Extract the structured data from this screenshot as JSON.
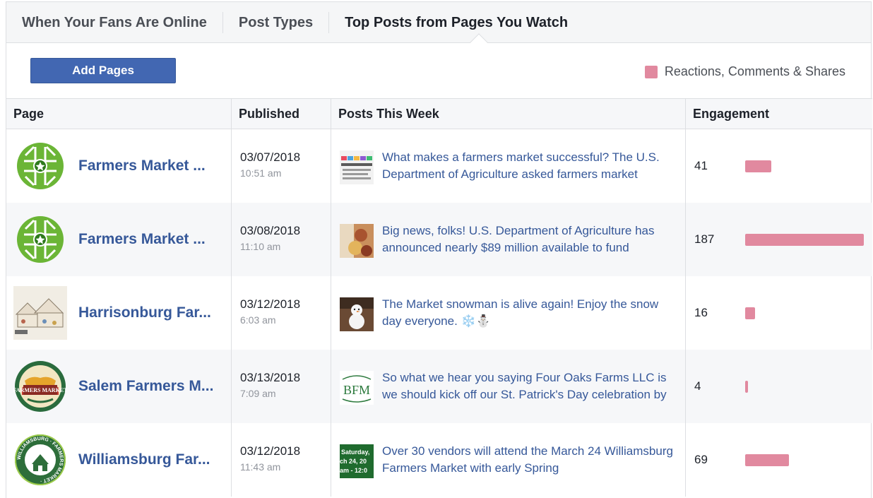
{
  "tabs": [
    {
      "label": "When Your Fans Are Online"
    },
    {
      "label": "Post Types"
    },
    {
      "label": "Top Posts from Pages You Watch"
    }
  ],
  "toolbar": {
    "add_pages_label": "Add Pages",
    "legend_label": "Reactions, Comments & Shares",
    "legend_color": "#e1899f"
  },
  "table": {
    "headers": [
      "Page",
      "Published",
      "Posts This Week",
      "Engagement"
    ],
    "max_engagement": 187,
    "rows": [
      {
        "page": "Farmers Market ...",
        "logo": "farmers-market-coalition-logo",
        "date": "03/07/2018",
        "time": "10:51 am",
        "post_thumb": "market-stalls-photo",
        "post": "What makes a farmers market successful? The U.S. Department of Agriculture asked farmers market",
        "engagement": "41",
        "engagement_value": 41
      },
      {
        "page": "Farmers Market ...",
        "logo": "farmers-market-coalition-logo",
        "date": "03/08/2018",
        "time": "11:10 am",
        "post_thumb": "produce-photo",
        "post": "Big news, folks! U.S. Department of Agriculture has announced nearly $89 million available to fund",
        "engagement": "187",
        "engagement_value": 187
      },
      {
        "page": "Harrisonburg Far...",
        "logo": "harrisonburg-market-sketch",
        "date": "03/12/2018",
        "time": "6:03 am",
        "post_thumb": "snowman-photo",
        "post": "The Market snowman is alive again! Enjoy the snow day everyone. ❄️⛄",
        "engagement": "16",
        "engagement_value": 16
      },
      {
        "page": "Salem Farmers M...",
        "logo": "salem-farmers-market-logo",
        "date": "03/13/2018",
        "time": "7:09 am",
        "post_thumb": "bfm-logo",
        "post": "So what we hear you saying Four Oaks Farms LLC is we should kick off our St. Patrick's Day celebration by",
        "engagement": "4",
        "engagement_value": 4
      },
      {
        "page": "Williamsburg Far...",
        "logo": "williamsburg-farmers-market-logo",
        "date": "03/12/2018",
        "time": "11:43 am",
        "post_thumb": "green-flyer",
        "post": "Over 30 vendors will attend the March 24 Williamsburg Farmers Market with early Spring",
        "engagement": "69",
        "engagement_value": 69
      }
    ]
  },
  "thumb_text": {
    "salem_logo": "FARMERS MARKET",
    "williamsburg_ring": "WILLIAMSBURG · FARMERS MARKET ·",
    "bfm": "BFM",
    "flyer_lines": [
      "Saturday,",
      "ch 24, 20",
      "am - 12:0"
    ]
  }
}
